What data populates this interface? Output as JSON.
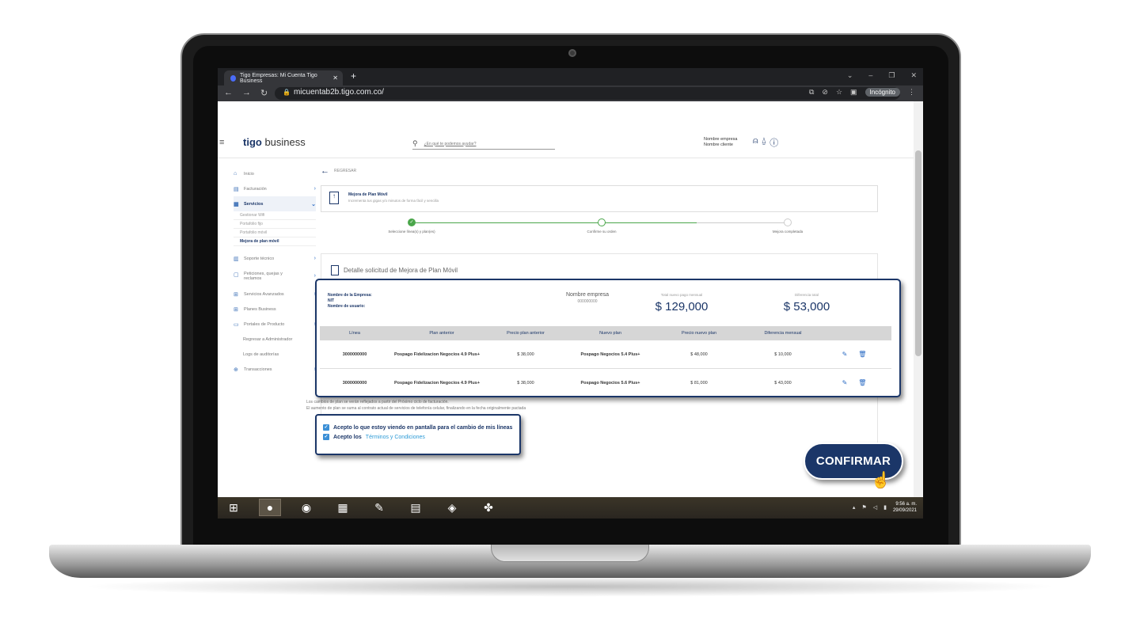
{
  "browser": {
    "tab_title": "Tigo Empresas: Mi Cuenta Tigo Business",
    "url": "micuentab2b.tigo.com.co/",
    "incognito_label": "Incógnito"
  },
  "header": {
    "logo_brand": "tigo",
    "logo_suffix": "business",
    "search_placeholder": "¿En qué te podemos ayudar?",
    "company_name": "Nombre empresa",
    "client_name": "Nombre cliente"
  },
  "sidebar": {
    "items": [
      {
        "label": "Inicio",
        "icon": "home-icon"
      },
      {
        "label": "Facturación",
        "icon": "invoice-icon"
      },
      {
        "label": "Servicios",
        "icon": "grid-icon"
      }
    ],
    "sub_items": [
      "Gestionar Wifi",
      "Portafolio fijo",
      "Portafolio móvil",
      "Mejora de plan móvil"
    ],
    "more_items": [
      {
        "label": "Soporte técnico",
        "icon": "support-icon"
      },
      {
        "label": "Peticiones, quejas y reclamos",
        "icon": "request-icon"
      },
      {
        "label": "Servicios Avanzados",
        "icon": "advanced-icon"
      },
      {
        "label": "Planes Business",
        "icon": "plans-icon"
      },
      {
        "label": "Portales de Producto",
        "icon": "portal-icon"
      }
    ],
    "plain_items": [
      "Regresar a Administrador",
      "Logs de auditorías"
    ],
    "last_item": {
      "label": "Transacciones",
      "icon": "transactions-icon"
    }
  },
  "main": {
    "back_label": "REGRESAR",
    "card_title": "Mejora de Plan Móvil",
    "card_subtitle": "Incrementa tus gigas y/o minutos de forma fácil y sencilla",
    "steps": [
      "Seleccione línea(s) y plan(es)",
      "Confirme su orden",
      "Mejora completada"
    ],
    "detail_title": "Detalle solicitud de Mejora de Plan Móvil",
    "notes": [
      "Los cambios de plan se verán reflejados a partir del Próximo ciclo de facturación.",
      "El aumento de plan se suma al contrato actual de servicios de telefonía celular, finalizando en la fecha originalmente pactada"
    ]
  },
  "summary": {
    "company_label": "Nombre de la Empresa:",
    "nit_label": "NIT",
    "user_label": "Nombre de usuario:",
    "company_name": "Nombre empresa",
    "company_number": "000000000",
    "total_caption": "Total nuevo pago mensual",
    "total_value": "$ 129,000",
    "diff_caption": "Diferencia total",
    "diff_value": "$ 53,000"
  },
  "table": {
    "headers": [
      "Línea",
      "Plan anterior",
      "Precio plan anterior",
      "Nuevo plan",
      "Precio nuevo plan",
      "Diferencia mensual"
    ],
    "rows": [
      {
        "linea": "3000000000",
        "plan_anterior": "Pospago Fidelizacion Negocios 4.9 Plus+",
        "precio_anterior": "$ 38,000",
        "nuevo_plan": "Pospago Negocios 5.4 Plus+",
        "precio_nuevo": "$ 48,000",
        "diferencia": "$ 10,000"
      },
      {
        "linea": "3000000000",
        "plan_anterior": "Pospago Fidelizacion Negocios 4.9 Plus+",
        "precio_anterior": "$ 38,000",
        "nuevo_plan": "Pospago Negocios 5.6 Plus+",
        "precio_nuevo": "$ 81,000",
        "diferencia": "$ 43,000"
      }
    ]
  },
  "checks": {
    "accept_screen": "Acepto lo que estoy viendo en pantalla para el cambio de mis líneas",
    "accept_terms_prefix": "Acepto los",
    "accept_terms_link": "Términos y Condiciones"
  },
  "confirm_label": "CONFIRMAR",
  "taskbar": {
    "time": "9:56 a. m.",
    "date": "29/09/2021"
  },
  "colors": {
    "brand_navy": "#1b3668",
    "success_green": "#4aa64a",
    "link_blue": "#2c9ad6"
  }
}
